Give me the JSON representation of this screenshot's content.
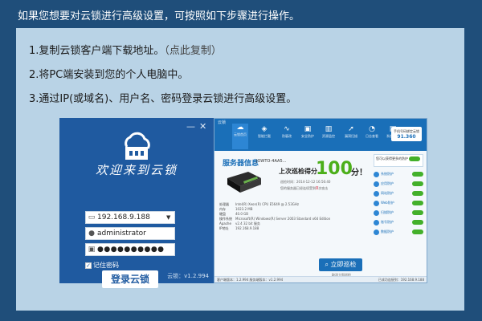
{
  "intro": "如果您想要对云锁进行高级设置，可按照如下步骤进行操作。",
  "steps": [
    {
      "text": "1.复制云锁客户端下载地址。",
      "link": "（点此复制）"
    },
    {
      "text": "2.将PC端安装到您的个人电脑中。"
    },
    {
      "text": "3.通过IP(或域名)、用户名、密码登录云锁进行高级设置。"
    }
  ],
  "login": {
    "minimize": "—",
    "close": "✕",
    "welcome": "欢迎来到云锁",
    "ip_value": "192.168.9.188",
    "username_value": "administrator",
    "password_dots": "●●●●●●●●●●",
    "remember": "记住密码",
    "login_button": "登录云锁",
    "version": "云锁：v1.2.994"
  },
  "app": {
    "title": "云锁",
    "tools": [
      "云锁首页",
      "智能拦截",
      "防篡改",
      "安全防护",
      "资源监控",
      "漏洞扫描",
      "日志查看",
      "系统设置"
    ],
    "phone_button": {
      "line1": "手机号码绑定云锁",
      "line2": "91.360"
    },
    "server_title": "服务器信息",
    "server_name": "JOWTO-4AA5...",
    "server_info": [
      {
        "k": "处理器",
        "v": "Intel(R) Xeon(R) CPU E5649 @ 2.53GHz"
      },
      {
        "k": "内存",
        "v": "1023.2 MB"
      },
      {
        "k": "硬盘",
        "v": "40.0 GB"
      },
      {
        "k": "操作系统",
        "v": "Microsoft(R) Windows(R) Server 2003 Standard x64 Edition"
      },
      {
        "k": "Apache",
        "v": "v2.4 32 bit 服务"
      },
      {
        "k": "IP地址",
        "v": "192.168.9.188"
      }
    ],
    "last_score_label": "上次巡检得分",
    "score": "100",
    "score_unit": "分！",
    "score_time": "巡检时间：2014-12-12 16:56:40",
    "score_note_prefix": "您的服务器已经连续受到",
    "score_note_count": "0",
    "score_note_suffix": "次攻击",
    "inspect_button": "立即巡检",
    "cancel_link": "取消立即巡检",
    "protect_label": "您可以获得更多的防护",
    "side_items": [
      "系统防护",
      "应用防护",
      "网站防护",
      "Web防护",
      "扫描防护",
      "账号防护",
      "数据防护"
    ],
    "status_left": "客户端版本：1.2.994   服务端版本：v1.2.994",
    "status_right": "已成功连接到：192.168.9.188"
  }
}
